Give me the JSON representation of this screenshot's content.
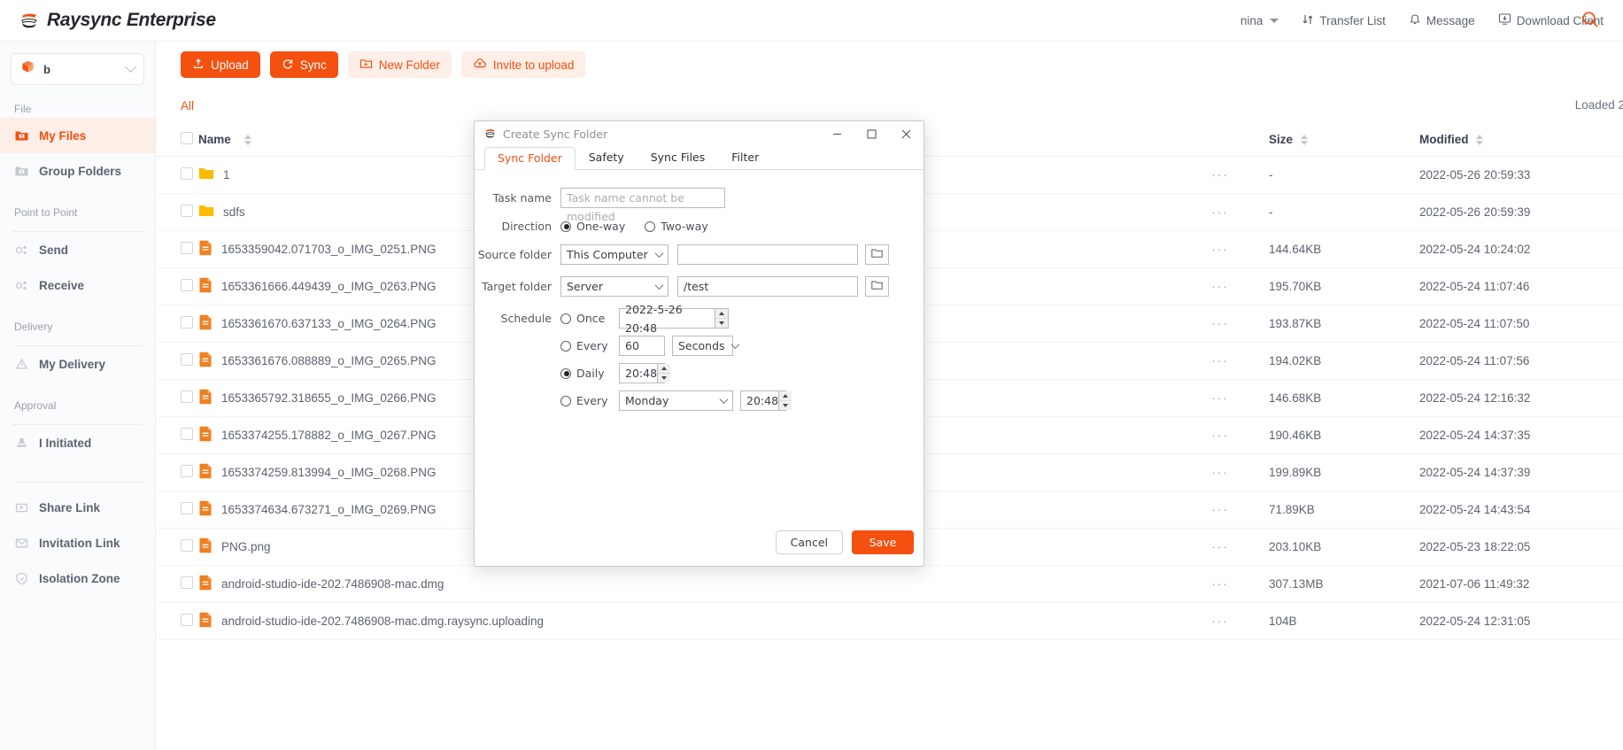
{
  "header": {
    "brand": "Raysync Enterprise",
    "brand_logo_icon": "raysync-logo-icon",
    "user": "nina",
    "transfer_list": "Transfer List",
    "message": "Message",
    "download_client": "Download Client"
  },
  "sidebar": {
    "space": {
      "label": "b",
      "icon": "box-icon"
    },
    "groups": [
      {
        "title": "File",
        "items": [
          {
            "label": "My Files",
            "icon": "my-files-icon",
            "active": true
          },
          {
            "label": "Group Folders",
            "icon": "group-folders-icon",
            "active": false
          }
        ]
      },
      {
        "title": "Point to Point",
        "items": [
          {
            "label": "Send",
            "icon": "send-icon",
            "active": false
          },
          {
            "label": "Receive",
            "icon": "receive-icon",
            "active": false
          }
        ]
      },
      {
        "title": "Delivery",
        "items": [
          {
            "label": "My Delivery",
            "icon": "delivery-icon",
            "active": false
          }
        ]
      },
      {
        "title": "Approval",
        "items": [
          {
            "label": "I Initiated",
            "icon": "approval-icon",
            "active": false
          }
        ]
      }
    ],
    "extra": [
      {
        "label": "Share Link",
        "icon": "share-link-icon"
      },
      {
        "label": "Invitation Link",
        "icon": "invitation-link-icon"
      },
      {
        "label": "Isolation Zone",
        "icon": "isolation-zone-icon"
      }
    ]
  },
  "toolbar": {
    "upload": "Upload",
    "sync": "Sync",
    "new_folder": "New Folder",
    "invite_to_upload": "Invite to upload"
  },
  "subbar": {
    "tab_all": "All",
    "loaded": "Loaded 2",
    "search_icon": "search-icon"
  },
  "table": {
    "columns": {
      "name": "Name",
      "size": "Size",
      "modified": "Modified"
    },
    "rows": [
      {
        "type": "folder",
        "name": "1",
        "size": "-",
        "modified": "2022-05-26 20:59:33"
      },
      {
        "type": "folder",
        "name": "sdfs",
        "size": "-",
        "modified": "2022-05-26 20:59:39"
      },
      {
        "type": "file",
        "name": "1653359042.071703_o_IMG_0251.PNG",
        "size": "144.64KB",
        "modified": "2022-05-24 10:24:02"
      },
      {
        "type": "file",
        "name": "1653361666.449439_o_IMG_0263.PNG",
        "size": "195.70KB",
        "modified": "2022-05-24 11:07:46"
      },
      {
        "type": "file",
        "name": "1653361670.637133_o_IMG_0264.PNG",
        "size": "193.87KB",
        "modified": "2022-05-24 11:07:50"
      },
      {
        "type": "file",
        "name": "1653361676.088889_o_IMG_0265.PNG",
        "size": "194.02KB",
        "modified": "2022-05-24 11:07:56"
      },
      {
        "type": "file",
        "name": "1653365792.318655_o_IMG_0266.PNG",
        "size": "146.68KB",
        "modified": "2022-05-24 12:16:32"
      },
      {
        "type": "file",
        "name": "1653374255.178882_o_IMG_0267.PNG",
        "size": "190.46KB",
        "modified": "2022-05-24 14:37:35"
      },
      {
        "type": "file",
        "name": "1653374259.813994_o_IMG_0268.PNG",
        "size": "199.89KB",
        "modified": "2022-05-24 14:37:39"
      },
      {
        "type": "file",
        "name": "1653374634.673271_o_IMG_0269.PNG",
        "size": "71.89KB",
        "modified": "2022-05-24 14:43:54"
      },
      {
        "type": "file",
        "name": "PNG.png",
        "size": "203.10KB",
        "modified": "2022-05-23 18:22:05"
      },
      {
        "type": "file",
        "name": "android-studio-ide-202.7486908-mac.dmg",
        "size": "307.13MB",
        "modified": "2021-07-06 11:49:32"
      },
      {
        "type": "file",
        "name": "android-studio-ide-202.7486908-mac.dmg.raysync.uploading",
        "size": "104B",
        "modified": "2022-05-24 12:31:05"
      }
    ],
    "row_menu": "···"
  },
  "dialog": {
    "title": "Create Sync Folder",
    "title_icon": "raysync-logo-icon",
    "window_controls": {
      "minimize": "minimize-icon",
      "maximize": "maximize-icon",
      "close": "close-icon"
    },
    "tabs": [
      {
        "label": "Sync Folder",
        "active": true
      },
      {
        "label": "Safety",
        "active": false
      },
      {
        "label": "Sync Files",
        "active": false
      },
      {
        "label": "Filter",
        "active": false
      }
    ],
    "fields": {
      "task_name_label": "Task name",
      "task_name_value": "",
      "task_name_placeholder": "Task name cannot be modified",
      "direction_label": "Direction",
      "direction_one_way": "One-way",
      "direction_two_way": "Two-way",
      "direction_selected": "One-way",
      "source_folder_label": "Source folder",
      "source_folder_select": "This Computer",
      "source_folder_path": "",
      "target_folder_label": "Target folder",
      "target_folder_select": "Server",
      "target_folder_path": "/test",
      "browse_icon": "folder-browse-icon",
      "schedule_label": "Schedule",
      "schedule_selected": "Daily",
      "once_label": "Once",
      "once_value": "2022-5-26 20:48",
      "every_interval_label": "Every",
      "every_interval_value": "60",
      "every_interval_unit": "Seconds",
      "daily_label": "Daily",
      "daily_value": "20:48",
      "every_weekday_label": "Every",
      "every_weekday_day": "Monday",
      "every_weekday_time": "20:48"
    },
    "buttons": {
      "cancel": "Cancel",
      "save": "Save"
    }
  },
  "colors": {
    "accent": "#f4500f",
    "accent_soft": "#fdeee7",
    "folder": "#fbbc04",
    "file": "#ef8022"
  }
}
